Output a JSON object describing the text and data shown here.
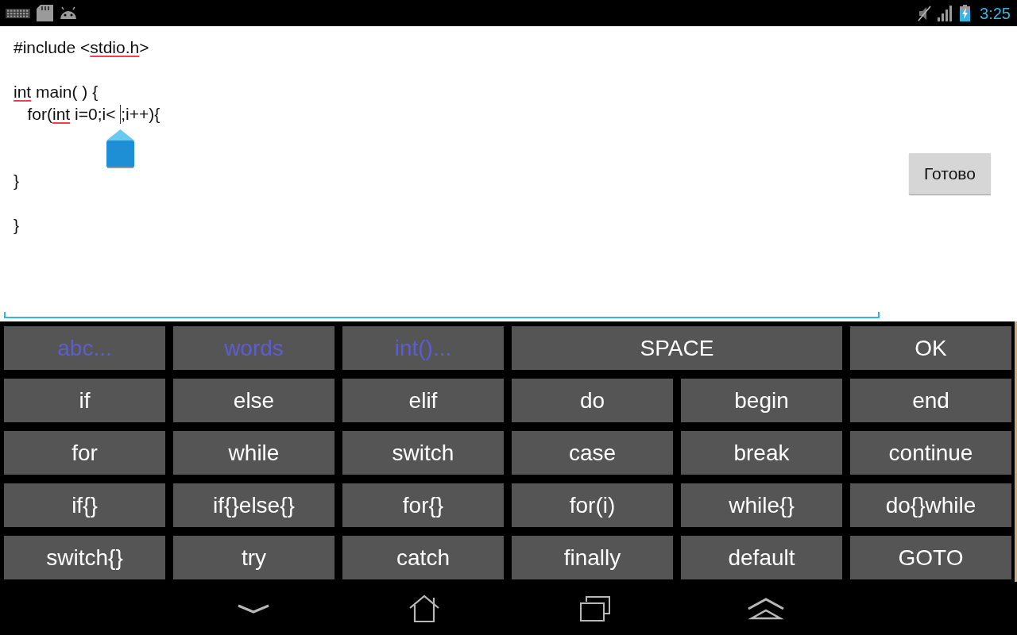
{
  "status_bar": {
    "time": "3:25"
  },
  "editor": {
    "lines": [
      {
        "kind": "code",
        "segments": [
          {
            "kind": "text",
            "text": "#include <",
            "misspelled": false
          },
          {
            "kind": "text",
            "text": "stdio.h",
            "misspelled": true
          },
          {
            "kind": "text",
            "text": ">",
            "misspelled": false
          }
        ]
      },
      {
        "kind": "blank"
      },
      {
        "kind": "code",
        "segments": [
          {
            "kind": "text",
            "text": "int",
            "misspelled": true
          },
          {
            "kind": "text",
            "text": " main( ) {",
            "misspelled": false
          }
        ]
      },
      {
        "kind": "code",
        "segments": [
          {
            "kind": "text",
            "text": "   for(",
            "misspelled": false
          },
          {
            "kind": "text",
            "text": "int",
            "misspelled": true
          },
          {
            "kind": "text",
            "text": " i=0;i< ",
            "misspelled": false
          },
          {
            "kind": "cursor"
          },
          {
            "kind": "text",
            "text": ";i++){",
            "misspelled": false
          }
        ]
      },
      {
        "kind": "blank"
      },
      {
        "kind": "blank"
      },
      {
        "kind": "code",
        "segments": [
          {
            "kind": "text",
            "text": "}",
            "misspelled": false
          }
        ]
      },
      {
        "kind": "blank"
      },
      {
        "kind": "code",
        "segments": [
          {
            "kind": "text",
            "text": "}",
            "misspelled": false
          }
        ]
      }
    ]
  },
  "done_button": {
    "label": "Готово"
  },
  "keyboard": {
    "keys": [
      {
        "label": "abc...",
        "kind": "mode"
      },
      {
        "label": "words",
        "kind": "mode"
      },
      {
        "label": "int()...",
        "kind": "mode"
      },
      {
        "label": "SPACE",
        "kind": "wide"
      },
      {
        "label": "OK",
        "kind": "key"
      },
      {
        "label": "if",
        "kind": "key"
      },
      {
        "label": "else",
        "kind": "key"
      },
      {
        "label": "elif",
        "kind": "key"
      },
      {
        "label": "do",
        "kind": "key"
      },
      {
        "label": "begin",
        "kind": "key"
      },
      {
        "label": "end",
        "kind": "key"
      },
      {
        "label": "for",
        "kind": "key"
      },
      {
        "label": "while",
        "kind": "key"
      },
      {
        "label": "switch",
        "kind": "key"
      },
      {
        "label": "case",
        "kind": "key"
      },
      {
        "label": "break",
        "kind": "key"
      },
      {
        "label": "continue",
        "kind": "key"
      },
      {
        "label": "if{}",
        "kind": "key"
      },
      {
        "label": "if{}else{}",
        "kind": "key"
      },
      {
        "label": "for{}",
        "kind": "key"
      },
      {
        "label": "for(i)",
        "kind": "key"
      },
      {
        "label": "while{}",
        "kind": "key"
      },
      {
        "label": "do{}while",
        "kind": "key"
      },
      {
        "label": "switch{}",
        "kind": "key"
      },
      {
        "label": "try",
        "kind": "key"
      },
      {
        "label": "catch",
        "kind": "key"
      },
      {
        "label": "finally",
        "kind": "key"
      },
      {
        "label": "default",
        "kind": "key"
      },
      {
        "label": "GOTO",
        "kind": "key"
      }
    ]
  }
}
